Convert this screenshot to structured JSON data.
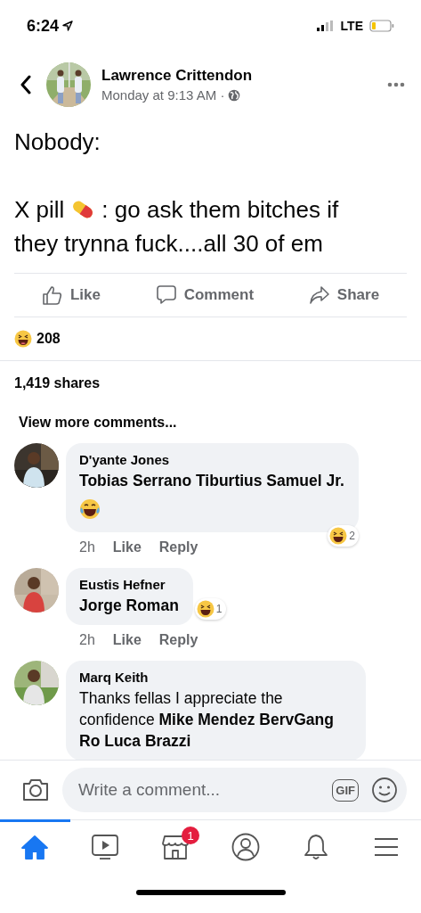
{
  "status_bar": {
    "time": "6:24",
    "network": "LTE"
  },
  "post": {
    "author": "Lawrence Crittendon",
    "timestamp": "Monday at 9:13 AM ·",
    "body": [
      {
        "kind": "text",
        "text": "Nobody:"
      },
      {
        "kind": "pill_line",
        "before": "X pill",
        "after": ": go ask them bitches if"
      },
      {
        "kind": "text",
        "text": "they trynna fuck....all 30 of em"
      }
    ],
    "actions": [
      {
        "kind": "like",
        "label": "Like"
      },
      {
        "kind": "comment",
        "label": "Comment"
      },
      {
        "kind": "share",
        "label": "Share"
      }
    ],
    "reaction_count": "208",
    "shares": "1,419 shares"
  },
  "view_more": "View more comments...",
  "comments": [
    {
      "author": "D'yante Jones",
      "body": "**Tobias Serrano Tiburtius Samuel Jr.**",
      "emoji_line": true,
      "reaction_count": "2",
      "time": "2h",
      "like": "Like",
      "reply": "Reply"
    },
    {
      "author": "Eustis Hefner",
      "body": "**Jorge Roman**",
      "emoji_line": false,
      "reaction_count": "1",
      "time": "2h",
      "like": "Like",
      "reply": "Reply"
    },
    {
      "author": "Marq Keith",
      "body": "Thanks fellas I appreciate the confidence **Mike Mendez** **BervGang Ro** **Luca Brazzi**",
      "emoji_line": false
    }
  ],
  "composer": {
    "placeholder": "Write a comment...",
    "gif": "GIF"
  },
  "tab_bar": [
    {
      "kind": "home",
      "selected": true
    },
    {
      "kind": "watch",
      "selected": false
    },
    {
      "kind": "marketplace",
      "selected": false,
      "badge": "1"
    },
    {
      "kind": "profile",
      "selected": false
    },
    {
      "kind": "notifications",
      "selected": false
    },
    {
      "kind": "menu",
      "selected": false
    }
  ]
}
